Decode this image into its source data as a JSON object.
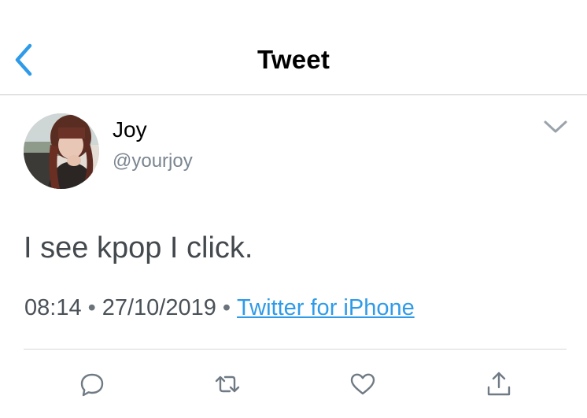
{
  "nav": {
    "title": "Tweet",
    "back_icon": "chevron-left-icon"
  },
  "tweet": {
    "display_name": "Joy",
    "handle": "@yourjoy",
    "text": "I see kpop I click.",
    "time": "08:14",
    "date": "27/10/2019",
    "source": "Twitter for iPhone",
    "separator": "•"
  },
  "actions": {
    "reply_icon": "reply-icon",
    "retweet_icon": "retweet-icon",
    "like_icon": "like-icon",
    "share_icon": "share-icon"
  },
  "colors": {
    "accent": "#2f9be8",
    "secondary_text": "#7a8590",
    "icon_gray": "#7a8590"
  }
}
